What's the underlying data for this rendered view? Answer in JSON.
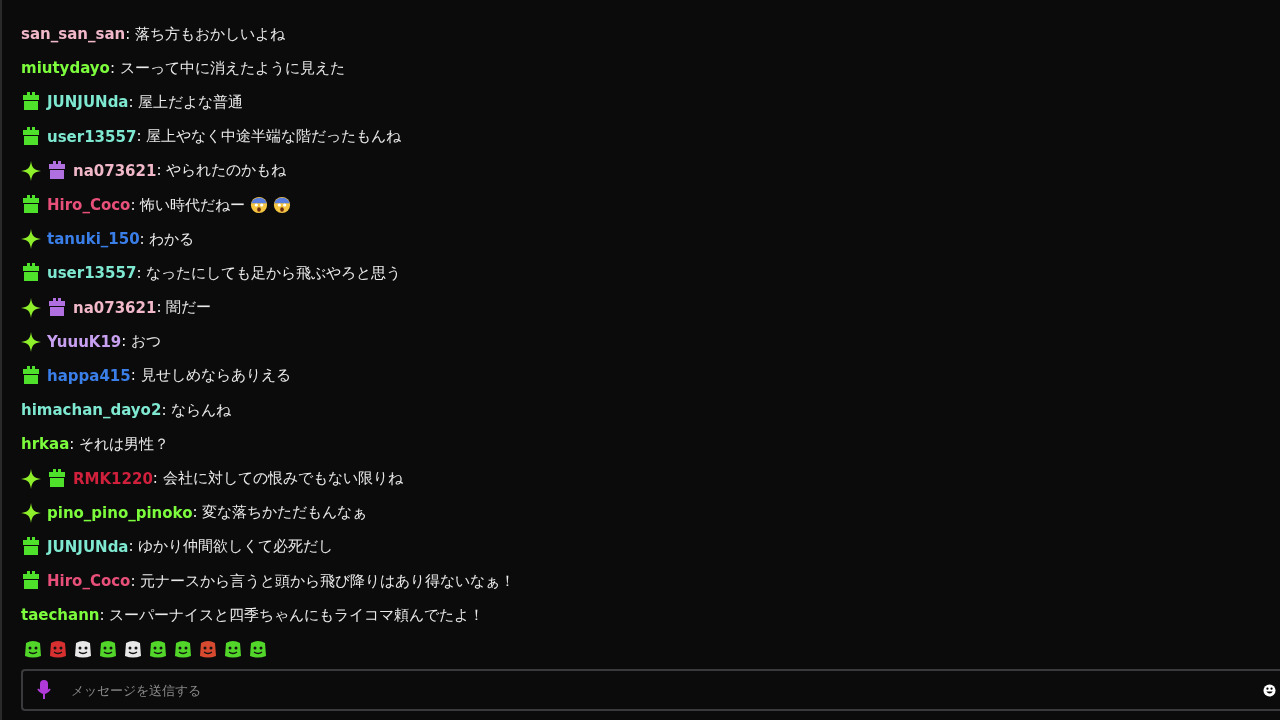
{
  "messages": [
    {
      "user": "san_san_san",
      "color": "#f0b8c8",
      "text": ": 落ち方もおかしいよね"
    },
    {
      "user": "miutydayo",
      "color": "#7cfc3c",
      "text": ": スーって中に消えたように見えた"
    },
    {
      "badges": [
        {
          "kind": "gift"
        }
      ],
      "user": "JUNJUNda",
      "color": "#7fe8d0",
      "text": ": 屋上だよな普通"
    },
    {
      "badges": [
        {
          "kind": "gift"
        }
      ],
      "user": "user13557",
      "color": "#7fe8d0",
      "text": ": 屋上やなく中途半端な階だったもんね"
    },
    {
      "badges": [
        {
          "kind": "sparkle"
        },
        {
          "kind": "gift-purple"
        }
      ],
      "user": "na073621",
      "color": "#f0b8c8",
      "text": ": やられたのかもね"
    },
    {
      "badges": [
        {
          "kind": "gift"
        }
      ],
      "user": "Hiro_Coco",
      "color": "#e8507a",
      "text": ": 怖い時代だねー",
      "emotes": [
        {
          "kind": "fearful"
        },
        {
          "kind": "fearful"
        }
      ]
    },
    {
      "badges": [
        {
          "kind": "sparkle"
        }
      ],
      "user": "tanuki_150",
      "color": "#3a7ee8",
      "text": ": わかる"
    },
    {
      "badges": [
        {
          "kind": "gift"
        }
      ],
      "user": "user13557",
      "color": "#7fe8d0",
      "text": ": なったにしても足から飛ぶやろと思う"
    },
    {
      "badges": [
        {
          "kind": "sparkle"
        },
        {
          "kind": "gift-purple"
        }
      ],
      "user": "na073621",
      "color": "#f0b8c8",
      "text": ": 闇だー"
    },
    {
      "badges": [
        {
          "kind": "sparkle"
        }
      ],
      "user": "YuuuK19",
      "color": "#c8a0f0",
      "text": ": おつ"
    },
    {
      "badges": [
        {
          "kind": "gift"
        }
      ],
      "user": "happa415",
      "color": "#3a7ee8",
      "text": ": 見せしめならありえる"
    },
    {
      "user": "himachan_dayo2",
      "color": "#7fe8d0",
      "text": ": ならんね"
    },
    {
      "user": "hrkaa",
      "color": "#7cfc3c",
      "text": ": それは男性？"
    },
    {
      "badges": [
        {
          "kind": "sparkle"
        },
        {
          "kind": "gift"
        }
      ],
      "user": "RMK1220",
      "color": "#d0203c",
      "text": ": 会社に対しての恨みでもない限りね"
    },
    {
      "badges": [
        {
          "kind": "sparkle"
        }
      ],
      "user": "pino_pino_pinoko",
      "color": "#7cfc3c",
      "text": ": 変な落ちかただもんなぁ"
    },
    {
      "badges": [
        {
          "kind": "gift"
        }
      ],
      "user": "JUNJUNda",
      "color": "#7fe8d0",
      "text": ": ゆかり仲間欲しくて必死だし"
    },
    {
      "badges": [
        {
          "kind": "gift"
        }
      ],
      "user": "Hiro_Coco",
      "color": "#e8507a",
      "text": ": 元ナースから言うと頭から飛び降りはあり得ないなぁ！"
    },
    {
      "user": "taechann",
      "color": "#7cfc3c",
      "text": ": スーパーナイスと四季ちゃんにもライコマ頼んでたよ！"
    }
  ],
  "emote_bar": [
    {
      "color": "#52d62a"
    },
    {
      "color": "#d83030"
    },
    {
      "color": "#e8e8e8"
    },
    {
      "color": "#52d62a"
    },
    {
      "color": "#e8e8e8"
    },
    {
      "color": "#52d62a"
    },
    {
      "color": "#52d62a"
    },
    {
      "color": "#d84a30"
    },
    {
      "color": "#52d62a"
    },
    {
      "color": "#52d62a"
    }
  ],
  "input": {
    "placeholder": "メッセージを送信する"
  }
}
